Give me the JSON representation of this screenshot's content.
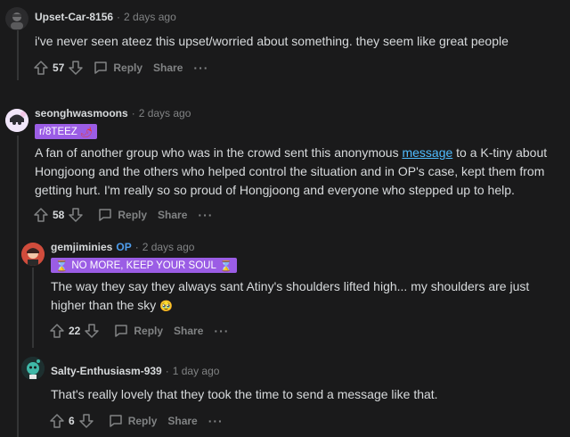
{
  "comments": [
    {
      "username": "Upset-Car-8156",
      "time": "2 days ago",
      "text": "i've never seen ateez this upset/worried about something. they seem like great people",
      "votes": "57",
      "reply_label": "Reply",
      "share_label": "Share",
      "more_label": "···"
    },
    {
      "username": "seonghwasmoons",
      "time": "2 days ago",
      "flair": "r/8TEEZ",
      "flair_emoji": "🌶",
      "text_before": "A fan of another group who was in the crowd sent this anonymous ",
      "link_text": "message",
      "text_after": " to a K-tiny about Hongjoong and the others who helped control the situation and in OP's case, kept them from getting hurt. I'm really so so proud of Hongjoong and everyone who stepped up to help.",
      "votes": "58",
      "reply_label": "Reply",
      "share_label": "Share",
      "more_label": "···"
    },
    {
      "username": "gemjiminies",
      "op_label": "OP",
      "time": "2 days ago",
      "flair": "NO MORE, KEEP YOUR SOUL",
      "flair_emoji": "⌛",
      "text": "The way they say they always sant Atiny's shoulders lifted high... my shoulders are just higher than the sky",
      "text_emoji": "🥹",
      "votes": "22",
      "reply_label": "Reply",
      "share_label": "Share",
      "more_label": "···"
    },
    {
      "username": "Salty-Enthusiasm-939",
      "time": "1 day ago",
      "text": "That's really lovely that they took the time to send a message like that.",
      "votes": "6",
      "reply_label": "Reply",
      "share_label": "Share",
      "more_label": "···"
    }
  ],
  "colors": {
    "background": "#1a1a1b",
    "text": "#d7dadc",
    "meta": "#818384",
    "link": "#4fbcff",
    "op": "#4f9eed",
    "flair_red": "#9b5de5",
    "thread_line": "#343536"
  },
  "icons": [
    "upvote-icon",
    "downvote-icon",
    "comment-icon",
    "more-icon"
  ]
}
